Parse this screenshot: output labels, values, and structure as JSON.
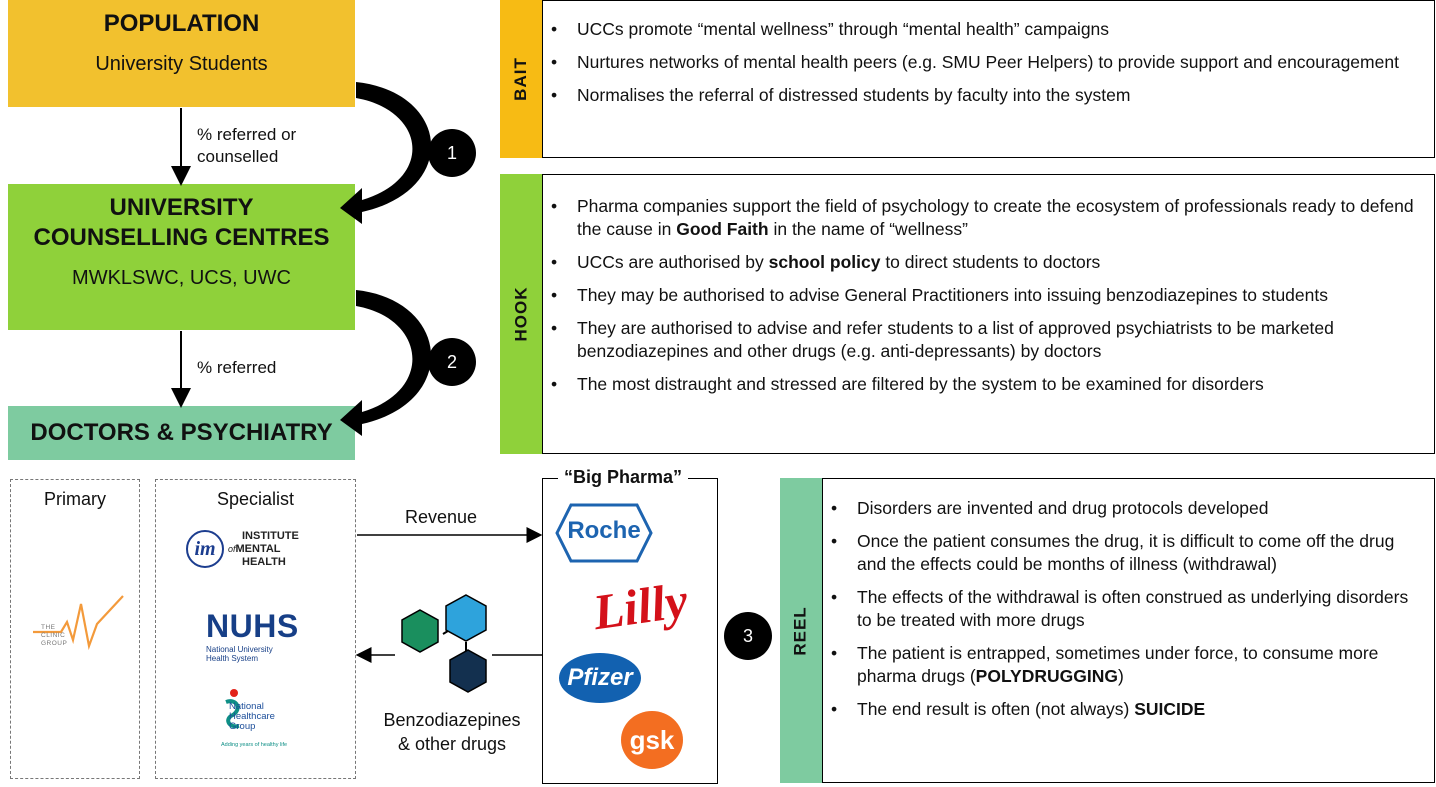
{
  "population": {
    "title": "POPULATION",
    "subtitle": "University Students"
  },
  "ucc": {
    "title_line1": "UNIVERSITY",
    "title_line2": "COUNSELLING CENTRES",
    "subtitle": "MWKLSWC, UCS, UWC"
  },
  "doctors": {
    "title": "DOCTORS & PSYCHIATRY"
  },
  "flow": {
    "label1_line1": "% referred or",
    "label1_line2": "counselled",
    "label2": "% referred",
    "step1": "1",
    "step2": "2",
    "step3": "3"
  },
  "bait": {
    "tab": "BAIT",
    "bullets": [
      {
        "text": "UCCs promote “mental wellness” through “mental health” campaigns"
      },
      {
        "text": "Nurtures networks of mental health peers (e.g. SMU Peer Helpers) to provide support and encouragement"
      },
      {
        "text": "Normalises the referral of distressed students by faculty into the system"
      }
    ]
  },
  "hook": {
    "tab": "HOOK",
    "bullet1_a": "Pharma companies support the field of psychology to create the ecosystem of professionals ready to defend the cause in ",
    "bullet1_bold": "Good Faith",
    "bullet1_b": " in the name of “wellness”",
    "bullet2_a": "UCCs are authorised by ",
    "bullet2_bold": "school policy",
    "bullet2_b": " to direct students to doctors",
    "bullet3": "They may be authorised to advise General Practitioners into issuing benzodiazepines to students",
    "bullet4": "They are authorised to advise and refer students to a list of approved psychiatrists to be marketed benzodiazepines and other drugs (e.g. anti-depressants) by doctors",
    "bullet5": "The most distraught and stressed are filtered by the system to be examined for disorders"
  },
  "reel": {
    "tab": "REEL",
    "bullet1": "Disorders are invented and drug protocols developed",
    "bullet2": "Once the patient consumes the drug, it is difficult to come off the drug and the effects could be months of illness (withdrawal)",
    "bullet3": "The effects of the withdrawal is often construed as underlying disorders to be treated with more drugs",
    "bullet4_a": "The patient is entrapped, sometimes under force, to consume more pharma drugs (",
    "bullet4_bold": "POLYDRUGGING",
    "bullet4_b": ")",
    "bullet5_a": "The end result is often (not always) ",
    "bullet5_bold": "SUICIDE"
  },
  "primary": {
    "title": "Primary",
    "logo": {
      "line1": "THE",
      "line2": "CLINIC",
      "line3": "GROUP"
    }
  },
  "specialist": {
    "title": "Specialist",
    "imh": {
      "mark": "im",
      "line1": "INSTITUTE",
      "line2": "MENTAL",
      "line3": "HEALTH",
      "of": "of"
    },
    "nuhs": {
      "name": "NUHS",
      "line1": "National University",
      "line2": "Health System"
    },
    "nhg": {
      "line1": "National",
      "line2": "Healthcare",
      "line3": "Group",
      "tagline": "Adding years of healthy life"
    }
  },
  "revenue": {
    "label": "Revenue"
  },
  "drugs": {
    "label_line1": "Benzodiazepines",
    "label_line2": "& other drugs"
  },
  "pharma": {
    "title": "“Big Pharma”",
    "roche": "Roche",
    "lilly": "Lilly",
    "pfizer": "Pfizer",
    "gsk": "gsk"
  },
  "colors": {
    "population": "#f2c12e",
    "ucc": "#8fd13a",
    "doctors": "#7ecba0",
    "bait_tab": "#f7bb14",
    "hook_tab": "#8fd13a",
    "reel_tab": "#7ecba0"
  }
}
